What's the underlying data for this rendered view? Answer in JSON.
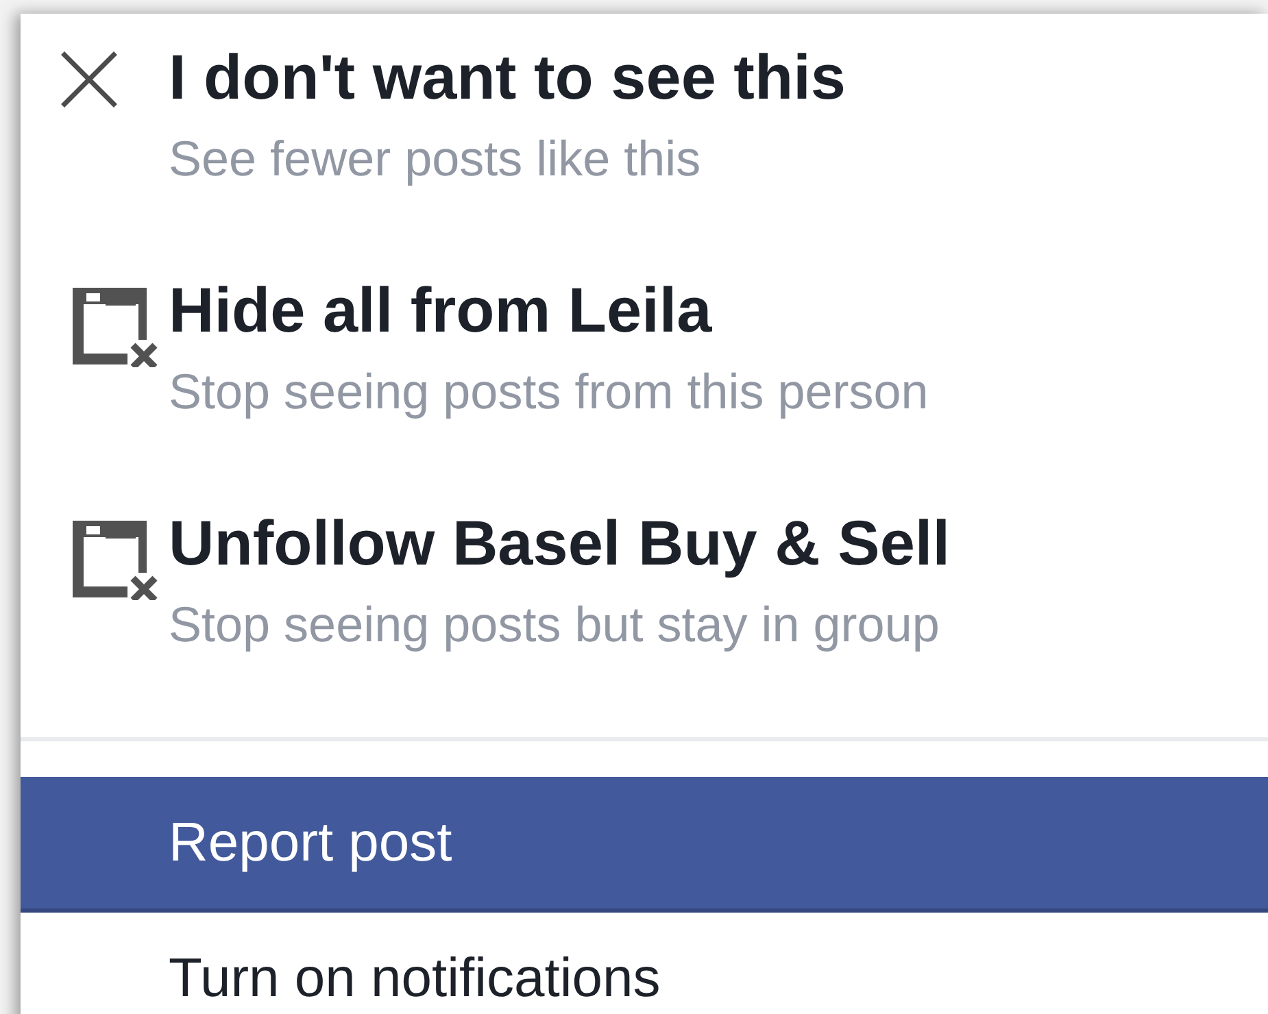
{
  "menu": {
    "primary_items": [
      {
        "kind": "close",
        "title": "I don't want to see this",
        "subtitle": "See fewer posts like this"
      },
      {
        "kind": "hide",
        "title": "Hide all from Leila",
        "subtitle": "Stop seeing posts from this person"
      },
      {
        "kind": "hide",
        "title": "Unfollow Basel Buy & Sell",
        "subtitle": "Stop seeing posts but stay in group"
      }
    ],
    "secondary_items": [
      {
        "label": "Report post",
        "selected": true
      },
      {
        "label": "Turn on notifications",
        "selected": false
      }
    ]
  }
}
